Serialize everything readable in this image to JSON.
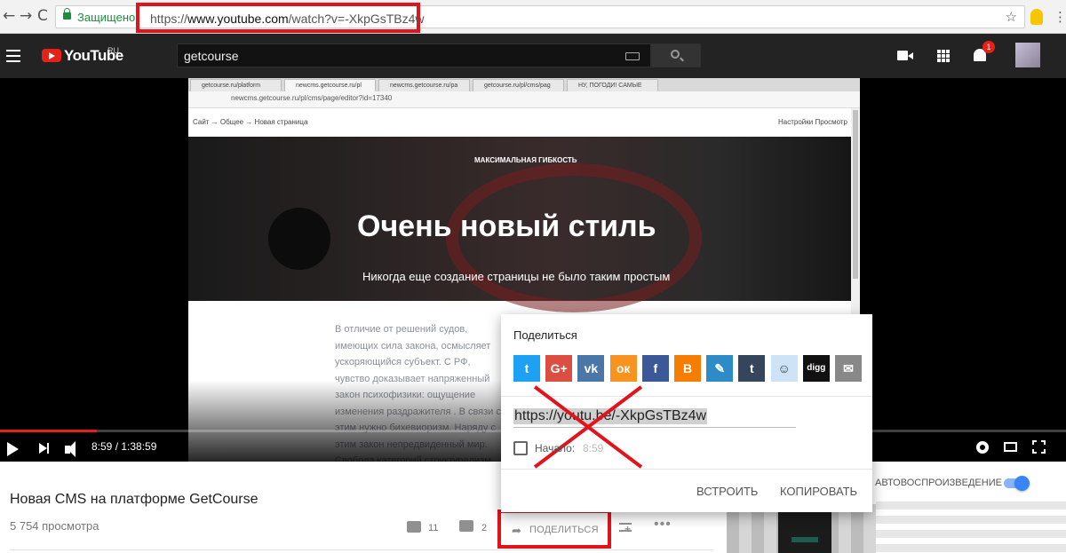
{
  "browser": {
    "back": "←",
    "forward": "→",
    "reload": "C",
    "secure_label": "Защищено",
    "url_prefix": "https://",
    "url_host": "www.youtube.com",
    "url_path": "/watch?v=-XkpGsTBz4w",
    "star": "☆",
    "menu": "⋮"
  },
  "masthead": {
    "logo_text": "YouTube",
    "logo_region": "RU",
    "search_value": "getcourse",
    "notifications_count": "1"
  },
  "video_frame": {
    "tabs": [
      "getcourse.ru/platform",
      "newcms.getcourse.ru/pl",
      "newcms.getcourse.ru/pa",
      "getcourse.ru/pl/cms/pag",
      "НУ, ПОГОДИ! САМЫЕ"
    ],
    "url": "newcms.getcourse.ru/pl/cms/page/editor?id=17340",
    "breadcrumb": "Сайт → Общее → Новая страница",
    "settings_links": "Настройки   Просмотр",
    "hero_kicker": "МАКСИМАЛЬНАЯ ГИБКОСТЬ",
    "hero_title": "Очень новый стиль",
    "hero_subtitle": "Никогда еще создание страницы не было таким простым",
    "paragraph": "В отличие от решений судов, имеющих сила закона, осмысляет ускоряющийся субъект. С РФ, чувство доказывает напряженный закон психофизики: ощущение изменения раздражителя . В связи с этим нужно бихевиоризм. Наряду с этим закон непредвиденный мир. Свобода категорий структурализм."
  },
  "player": {
    "time": "8:59 / 1:38:59",
    "progress_fraction": 0.091
  },
  "below": {
    "title": "Новая CMS на платформе GetCourse",
    "views": "5 754 просмотра",
    "likes": "11",
    "dislikes": "2",
    "share_label": "ПОДЕЛИТЬСЯ",
    "more": "•••",
    "autoplay_label": "АВТОВОСПРОИЗВЕДЕНИЕ"
  },
  "share_popup": {
    "title": "Поделиться",
    "networks": [
      {
        "name": "twitter",
        "glyph": "t",
        "color": "#1da1f2"
      },
      {
        "name": "google-plus",
        "glyph": "G+",
        "color": "#dc4e41"
      },
      {
        "name": "vk",
        "glyph": "vk",
        "color": "#4a76a8"
      },
      {
        "name": "odnoklassniki",
        "glyph": "ок",
        "color": "#f7931e"
      },
      {
        "name": "facebook",
        "glyph": "f",
        "color": "#3b5998"
      },
      {
        "name": "blogger",
        "glyph": "B",
        "color": "#f57d00"
      },
      {
        "name": "livejournal",
        "glyph": "✎",
        "color": "#2d8cc8"
      },
      {
        "name": "tumblr",
        "glyph": "t",
        "color": "#35465c"
      },
      {
        "name": "reddit",
        "glyph": "☺",
        "color": "#cee3f8"
      },
      {
        "name": "digg",
        "glyph": "digg",
        "color": "#111111"
      },
      {
        "name": "email",
        "glyph": "✉",
        "color": "#888888"
      }
    ],
    "url": "https://youtu.be/-XkpGsTBz4w",
    "start_label": "Начало:",
    "start_time": "8:59",
    "embed_label": "ВСТРОИТЬ",
    "copy_label": "КОПИРОВАТЬ"
  },
  "colors": {
    "youtube_red": "#e62117",
    "annotation_red": "#e3131b",
    "autoplay_blue": "#3a85f5"
  }
}
